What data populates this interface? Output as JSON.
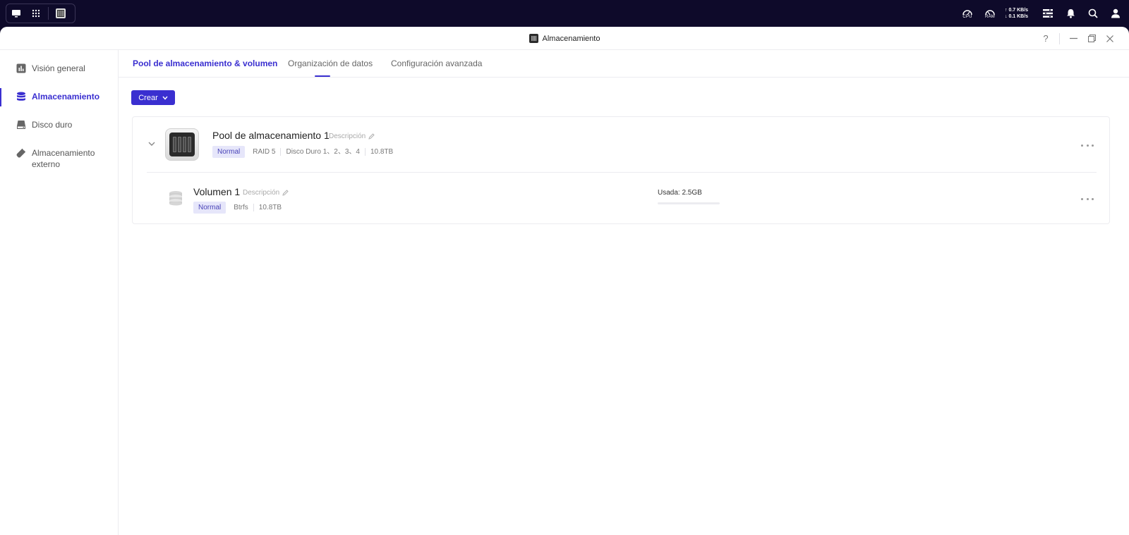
{
  "system_bar": {
    "cpu_label": "CPU",
    "ram_label": "RAM",
    "net_up": "0.7 KB/s",
    "net_down": "0.1 KB/s"
  },
  "window": {
    "title": "Almacenamiento",
    "help": "?"
  },
  "sidebar": {
    "items": [
      {
        "label": "Visión general",
        "icon": "chart-icon"
      },
      {
        "label": "Almacenamiento",
        "icon": "database-icon",
        "active": true
      },
      {
        "label": "Disco duro",
        "icon": "hard-drive-icon"
      },
      {
        "label": "Almacenamiento externo",
        "icon": "usb-drive-icon"
      }
    ]
  },
  "tabs": [
    {
      "label": "Pool de almacenamiento & volumen",
      "active": true
    },
    {
      "label": "Organización de datos"
    },
    {
      "label": "Configuración avanzada"
    }
  ],
  "create_button": "Crear",
  "pool": {
    "name": "Pool de almacenamiento 1",
    "description_placeholder": "Descripción",
    "status": "Normal",
    "raid": "RAID 5",
    "disks": "Disco Duro 1、2、3、4",
    "capacity": "10.8TB"
  },
  "volume": {
    "name": "Volumen 1",
    "description_placeholder": "Descripción",
    "status": "Normal",
    "filesystem": "Btrfs",
    "capacity": "10.8TB",
    "usage_label": "Usada: 2.5GB",
    "usage_fraction": 0.0002
  },
  "colors": {
    "accent": "#3a2fd0",
    "system_bar": "#0e0a2a"
  }
}
